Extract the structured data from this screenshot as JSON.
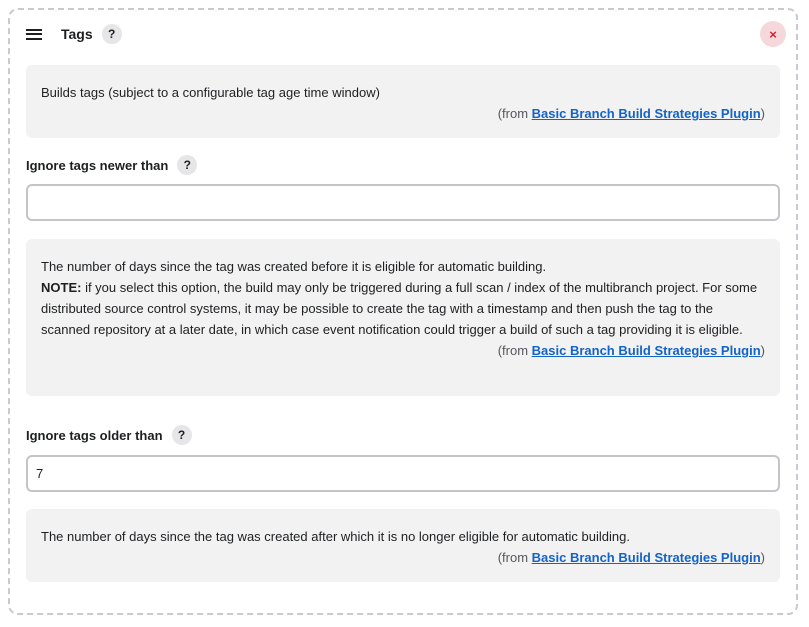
{
  "header": {
    "title": "Tags",
    "help_label": "?",
    "close_label": "×"
  },
  "intro_help": {
    "text": "Builds tags (subject to a configurable tag age time window)",
    "source_prefix": "(from ",
    "source_link": "Basic Branch Build Strategies Plugin",
    "source_suffix": ")"
  },
  "newer_field": {
    "label": "Ignore tags newer than",
    "help_label": "?",
    "value": "",
    "help": {
      "line1": "The number of days since the tag was created before it is eligible for automatic building.",
      "note_label": "NOTE:",
      "note_text": " if you select this option, the build may only be triggered during a full scan / index of the multibranch project. For some distributed source control systems, it may be possible to create the tag with a timestamp and then push the tag to the scanned repository at a later date, in which case event notification could trigger a build of such a tag providing it is eligible.",
      "source_prefix": "(from ",
      "source_link": "Basic Branch Build Strategies Plugin",
      "source_suffix": ")"
    }
  },
  "older_field": {
    "label": "Ignore tags older than",
    "help_label": "?",
    "value": "7",
    "help": {
      "text": "The number of days since the tag was created after which it is no longer eligible for automatic building.",
      "source_prefix": "(from ",
      "source_link": "Basic Branch Build Strategies Plugin",
      "source_suffix": ")"
    }
  }
}
